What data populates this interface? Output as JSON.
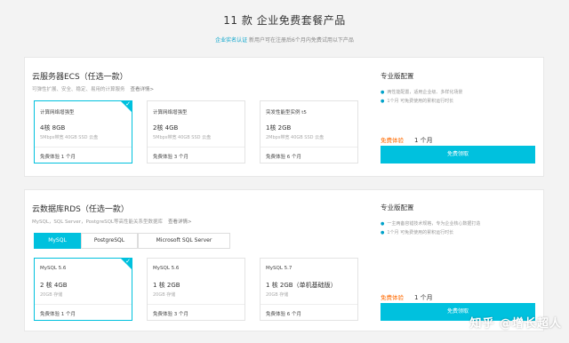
{
  "header": {
    "title": "11 款 企业免费套餐产品",
    "subtitle_link": "企业实名认证",
    "subtitle_rest": " 新用户可在注册后6个月内免费试用以下产品"
  },
  "ecs": {
    "title": "云服务器ECS（任选一款）",
    "desc": "可弹性扩展、安全、稳定、易用的计算服务",
    "more": "查看详情>",
    "cards": [
      {
        "name": "计算网络增强型",
        "spec": "4核 8GB",
        "detail": "5Mbps带宽  40GB SSD 云盘",
        "trial": "免费体验 1 个月"
      },
      {
        "name": "计算网络增强型",
        "spec": "2核 4GB",
        "detail": "5Mbps带宽  40GB SSD 云盘",
        "trial": "免费体验 3 个月"
      },
      {
        "name": "突发性能型实例 t5",
        "spec": "1核 2GB",
        "detail": "2Mbps带宽  40GB SSD 云盘",
        "trial": "免费体验 6 个月"
      }
    ],
    "side": {
      "title": "专业版配置",
      "items": [
        "两性能配置，适用企业级、多样化场景",
        "1个月 可免费使用的累积运行时长"
      ],
      "trial_label": "免费体验",
      "trial_value": "1 个月",
      "button": "免费领取"
    }
  },
  "rds": {
    "title": "云数据库RDS（任选一款）",
    "desc": "MySQL，SQL Server，PostgreSQL等高性能关系型数据库",
    "more": "查看详情>",
    "tabs": [
      "MySQL",
      "PostgreSQL",
      "Microsoft SQL Server"
    ],
    "active_tab": "MySQL",
    "cards": [
      {
        "name": "MySQL 5.6",
        "spec": "2 核 4GB",
        "detail": "20GB 存储",
        "trial": "免费体验 1 个月"
      },
      {
        "name": "MySQL 5.6",
        "spec": "1 核 2GB",
        "detail": "20GB 存储",
        "trial": "免费体验 3 个月"
      },
      {
        "name": "MySQL 5.7",
        "spec": "1 核 2GB（单机基础版）",
        "detail": "20GB 存储",
        "trial": "免费体验 6 个月"
      }
    ],
    "side": {
      "title": "专业版配置",
      "items": [
        "一主两备容错技术规格，专为企业核心数据打造",
        "1个月 可免费使用的累积运行时长"
      ],
      "trial_label": "免费体验",
      "trial_value": "1 个月",
      "button": "免费领取"
    }
  },
  "watermark": "知乎 @增长超人",
  "colors": {
    "accent": "#00c1de",
    "link": "#00a2ca",
    "trial": "#ff6a00"
  }
}
